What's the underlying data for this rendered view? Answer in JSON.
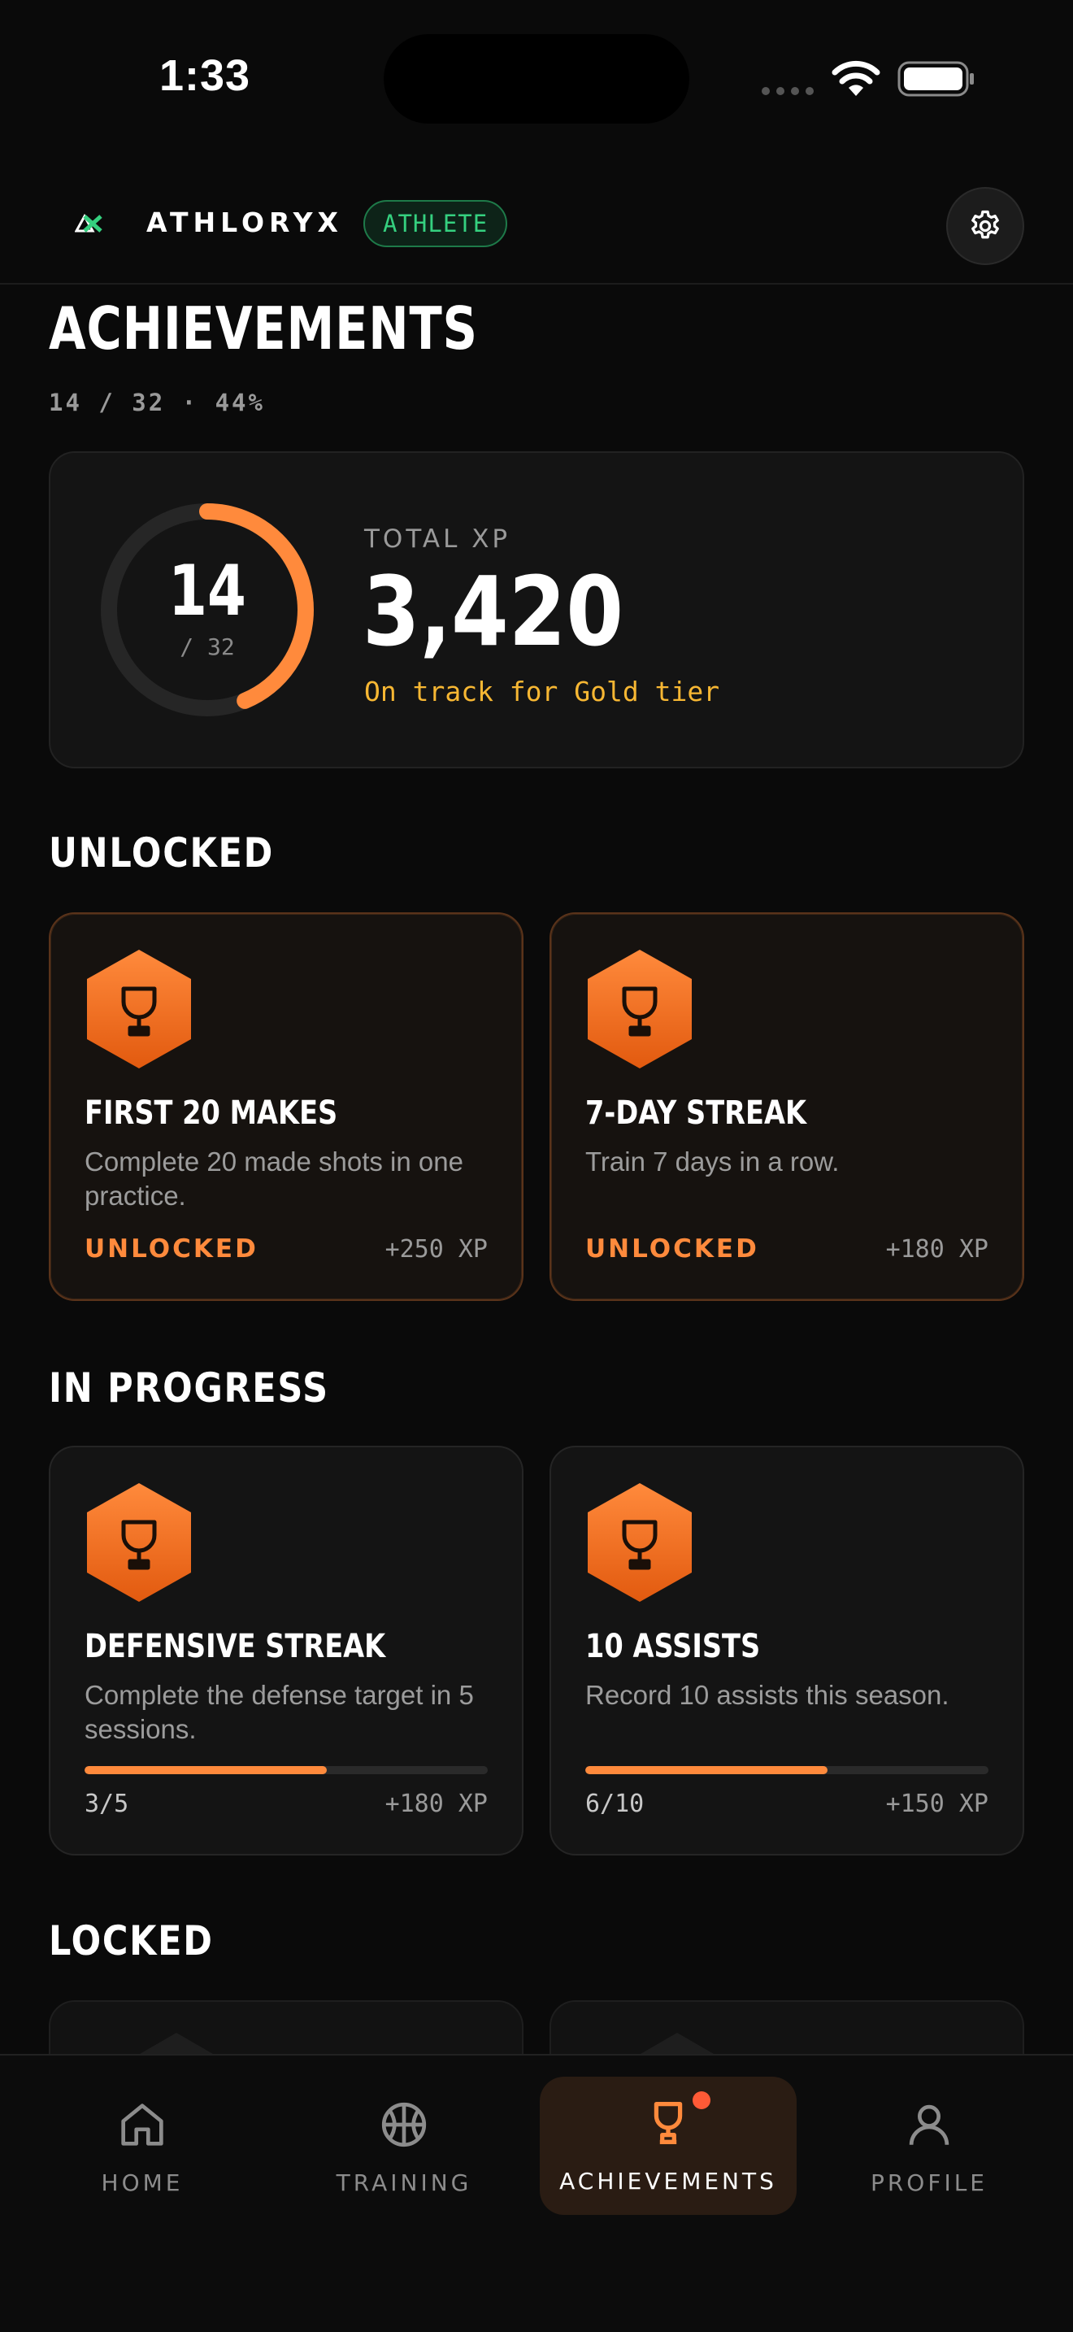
{
  "status_bar": {
    "time": "1:33"
  },
  "header": {
    "brand": "ATHLORYX",
    "role_badge": "ATHLETE",
    "settings_icon": "gear-icon"
  },
  "page": {
    "title": "ACHIEVEMENTS",
    "summary": "14 / 32 · 44%"
  },
  "xp_card": {
    "unlocked_count": "14",
    "total_count": "/ 32",
    "ring_fraction": 0.4375,
    "label": "TOTAL XP",
    "value": "3,420",
    "tier_text": "On track for Gold tier"
  },
  "sections": {
    "unlocked": "UNLOCKED",
    "in_progress": "IN PROGRESS",
    "locked": "LOCKED"
  },
  "unlocked_cards": [
    {
      "title": "FIRST 20 MAKES",
      "description": "Complete 20 made shots in one practice.",
      "status": "UNLOCKED",
      "xp": "+250 XP",
      "icon": "trophy-icon"
    },
    {
      "title": "7-DAY STREAK",
      "description": "Train 7 days in a row.",
      "status": "UNLOCKED",
      "xp": "+180 XP",
      "icon": "trophy-icon"
    }
  ],
  "in_progress_cards": [
    {
      "title": "DEFENSIVE STREAK",
      "description": "Complete the defense target in 5 sessions.",
      "progress_text": "3/5",
      "progress": 0.6,
      "xp": "+180 XP",
      "icon": "trophy-icon"
    },
    {
      "title": "10 ASSISTS",
      "description": "Record 10 assists this season.",
      "progress_text": "6/10",
      "progress": 0.6,
      "xp": "+150 XP",
      "icon": "trophy-icon"
    }
  ],
  "bottom_nav": {
    "items": [
      {
        "label": "HOME",
        "icon": "home-icon",
        "active": false
      },
      {
        "label": "TRAINING",
        "icon": "basketball-icon",
        "active": false
      },
      {
        "label": "ACHIEVEMENTS",
        "icon": "trophy-icon",
        "active": true
      },
      {
        "label": "PROFILE",
        "icon": "user-icon",
        "active": false
      }
    ]
  },
  "colors": {
    "accent": "#ff8a3c",
    "success": "#35d07f",
    "gold": "#f7b733",
    "background": "#0a0a0a"
  }
}
